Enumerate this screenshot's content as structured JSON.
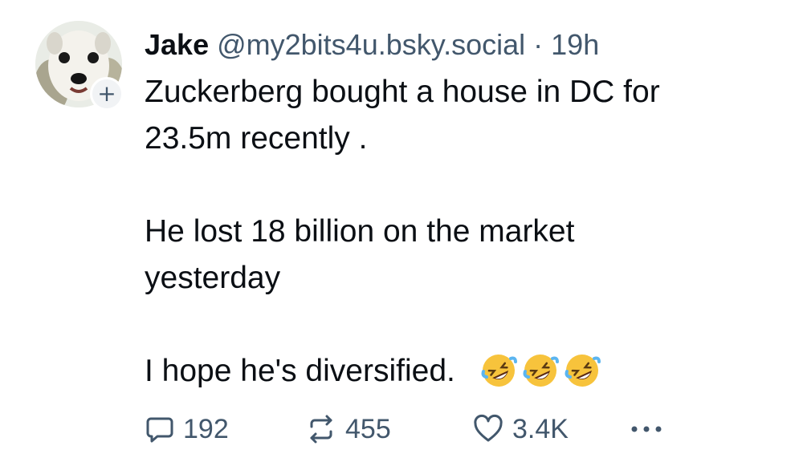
{
  "post": {
    "author": {
      "display_name": "Jake",
      "handle": "@my2bits4u.bsky.social",
      "separator": "·",
      "time": "19h",
      "follow_icon": "plus-icon",
      "follow_symbol": "+"
    },
    "text": {
      "p1_line1": "Zuckerberg bought a house in DC for",
      "p1_line2": "23.5m recently .",
      "p2_line1": "He lost 18 billion on the market",
      "p2_line2": "yesterday",
      "p3_line1": "I hope he's diversified.",
      "emoji_names": [
        "rolling-on-floor-laughing-icon",
        "rolling-on-floor-laughing-icon",
        "rolling-on-floor-laughing-icon"
      ]
    },
    "actions": {
      "reply_count": "192",
      "repost_count": "455",
      "like_count": "3.4K",
      "more_icon": "ellipsis-icon"
    },
    "colors": {
      "text": "#0b0f14",
      "muted": "#42576c",
      "emoji_face": "#f7c33c"
    }
  }
}
